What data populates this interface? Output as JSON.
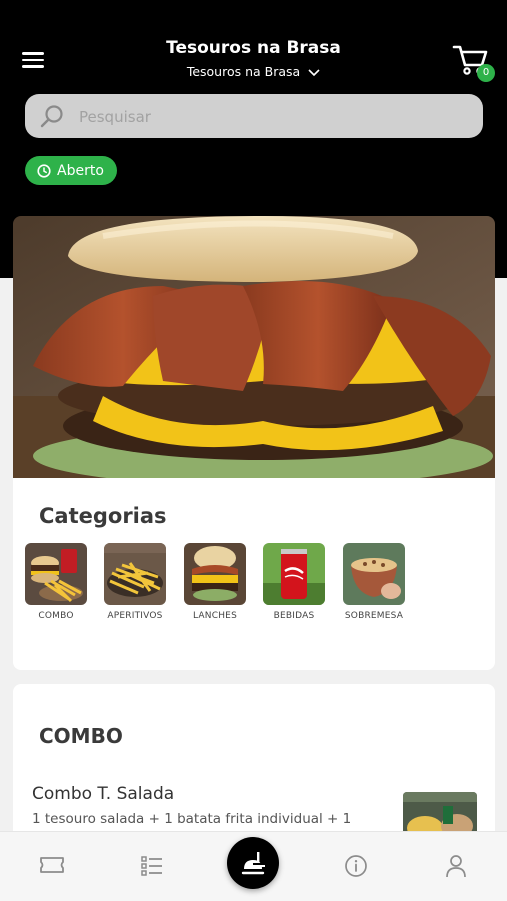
{
  "header": {
    "store_title": "Tesouros na Brasa",
    "store_selector": "Tesouros na Brasa",
    "cart_count": "0"
  },
  "search": {
    "placeholder": "Pesquisar"
  },
  "status": {
    "label": "Aberto"
  },
  "categories": {
    "title": "Categorias",
    "items": [
      {
        "label": "COMBO"
      },
      {
        "label": "APERITIVOS"
      },
      {
        "label": "LANCHES"
      },
      {
        "label": "BEBIDAS"
      },
      {
        "label": "SOBREMESA"
      }
    ]
  },
  "combo_section": {
    "title": "COMBO",
    "products": [
      {
        "name": "Combo T. Salada",
        "description": "1 tesouro salada + 1 batata frita individual + 1"
      }
    ]
  },
  "bottom_nav": {
    "items": [
      {
        "icon": "ticket-icon"
      },
      {
        "icon": "list-icon"
      },
      {
        "icon": "menu-food-icon"
      },
      {
        "icon": "info-icon"
      },
      {
        "icon": "user-icon"
      }
    ]
  },
  "colors": {
    "accent": "#2eb24a",
    "header": "#000000",
    "background": "#f1f1f1"
  }
}
